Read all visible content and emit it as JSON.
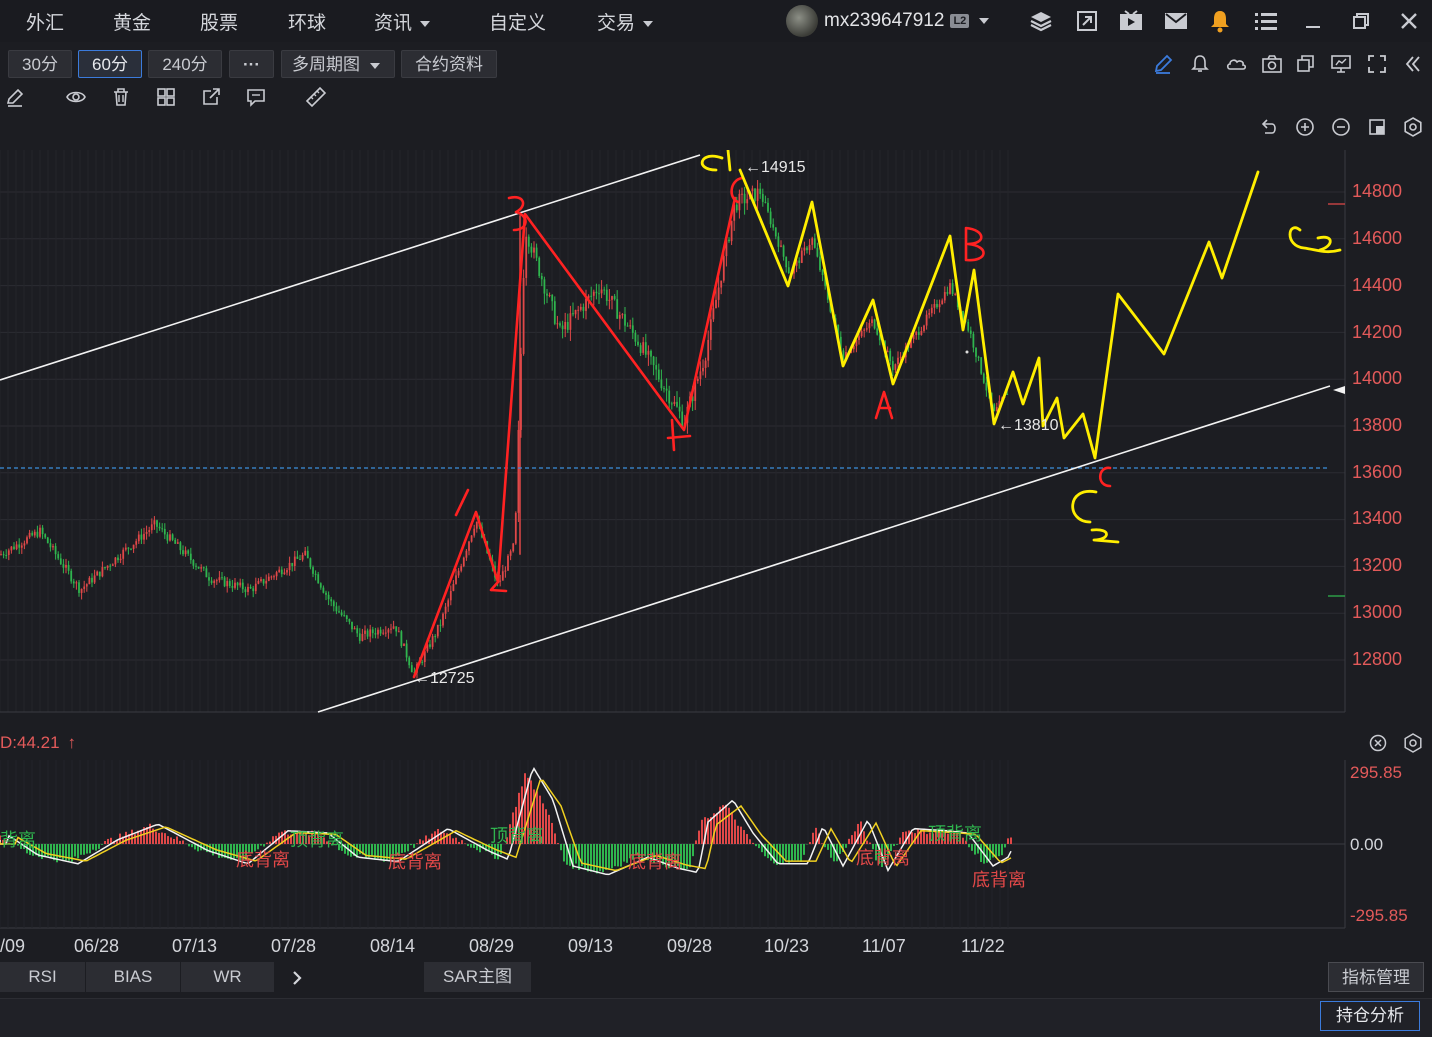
{
  "nav": {
    "items": [
      {
        "label": "外汇"
      },
      {
        "label": "黄金"
      },
      {
        "label": "股票"
      },
      {
        "label": "环球"
      },
      {
        "label": "资讯"
      },
      {
        "label": "自定义"
      },
      {
        "label": "交易"
      }
    ],
    "username": "mx239647912",
    "level_badge": "L2"
  },
  "periods": {
    "p30": "30分",
    "p60": "60分",
    "p240": "240分",
    "more": "···",
    "multi": "多周期图",
    "contract": "合约资料",
    "active": "60分"
  },
  "price_axis": [
    "14800",
    "14600",
    "14400",
    "14200",
    "14000",
    "13800",
    "13600",
    "13400",
    "13200",
    "13000",
    "12800"
  ],
  "date_axis": [
    "/09",
    "06/28",
    "07/13",
    "07/28",
    "08/14",
    "08/29",
    "09/13",
    "09/28",
    "10/23",
    "11/07",
    "11/22"
  ],
  "annotations": {
    "high": "←14915",
    "low": "←12725",
    "mid_low": "←13810"
  },
  "indicator": {
    "header": "D:44.21",
    "top": "295.85",
    "zero": "0.00",
    "bottom": "-295.85",
    "divergence_labels": [
      {
        "text": "背离",
        "color": "#2fb54e"
      },
      {
        "text": "顶背离",
        "color": "#2fb54e"
      },
      {
        "text": "顶背离",
        "color": "#2fb54e"
      },
      {
        "text": "顶背离",
        "color": "#2fb54e"
      },
      {
        "text": "底背离",
        "color": "#e04848"
      },
      {
        "text": "底背离",
        "color": "#e04848"
      },
      {
        "text": "底背离",
        "color": "#e04848"
      },
      {
        "text": "底背离",
        "color": "#e04848"
      },
      {
        "text": "底背离",
        "color": "#e04848"
      }
    ]
  },
  "bottom_tabs": {
    "rsi": "RSI",
    "bias": "BIAS",
    "wr": "WR",
    "sar": "SAR主图",
    "manage": "指标管理"
  },
  "status": {
    "position": "持仓分析"
  },
  "colors": {
    "up": "#e04848",
    "down": "#2fb54e",
    "handwriting_red": "#ff2020",
    "handwriting_yellow": "#ffee00",
    "accent": "#3b7bdc"
  },
  "handwriting": {
    "labels": [
      "C1",
      "C2",
      "C2",
      "1",
      "2",
      "3",
      "4",
      "5",
      "A",
      "B",
      "C"
    ]
  }
}
